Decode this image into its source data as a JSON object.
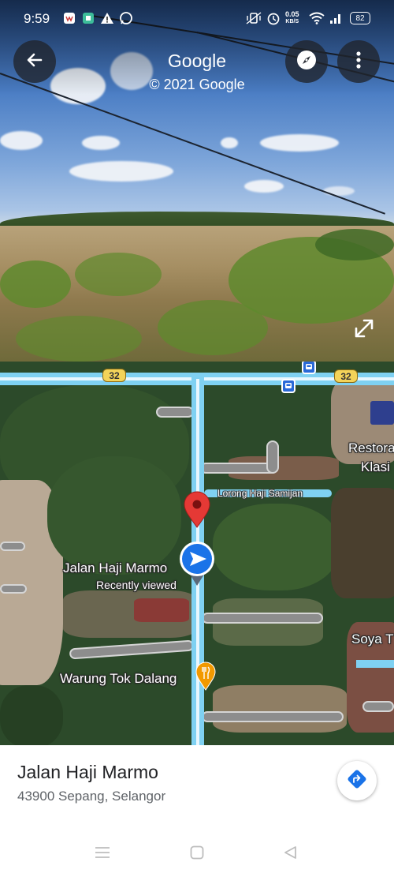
{
  "status_bar": {
    "time": "9:59",
    "net_speed_value": "0.05",
    "net_speed_unit": "KB/S",
    "battery": "82"
  },
  "street_view": {
    "title": "Google",
    "copyright": "© 2021 Google",
    "icons": {
      "back": "back-arrow-icon",
      "compass": "compass-icon",
      "menu": "more-vert-icon",
      "expand": "expand-icon"
    }
  },
  "map": {
    "route_shield_1": "32",
    "route_shield_2": "32",
    "street_label": "Lorong Haji Samijan",
    "place_labels": {
      "restoran_1": "Restora",
      "restoran_2": "Klasi",
      "soya": "Soya T",
      "warung": "Warung Tok Dalang"
    },
    "pin_title": "Jalan Haji Marmo",
    "pin_subtitle": "Recently viewed",
    "colors": {
      "main_road": "#7fd1f2",
      "pin": "#e53935",
      "location_arrow": "#1a73e8",
      "food_marker": "#f29900"
    }
  },
  "place": {
    "name": "Jalan Haji Marmo",
    "address": "43900 Sepang, Selangor"
  }
}
